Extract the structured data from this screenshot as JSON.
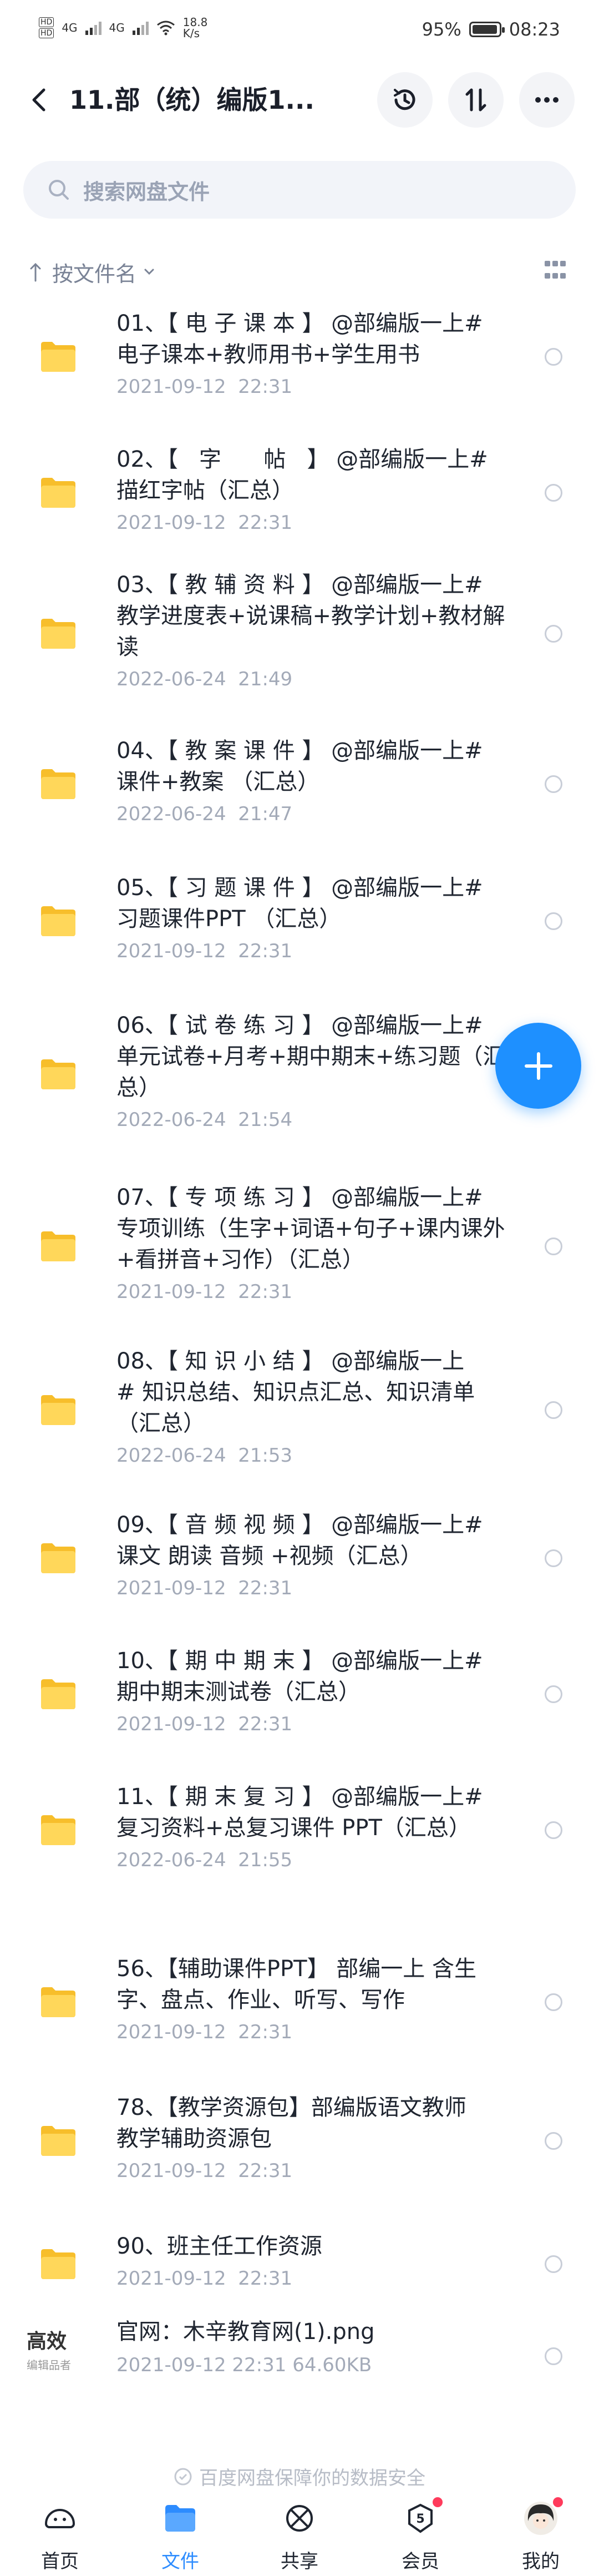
{
  "status": {
    "hd1": "HD",
    "hd2": "HD",
    "net1": "4G",
    "net2": "4G",
    "speed_value": "18.8",
    "speed_unit": "K/s",
    "battery_pct": "95%",
    "battery_level": 0.95,
    "time": "08:23"
  },
  "header": {
    "title": "11.部（统）编版1...",
    "back_icon": "chevron-left-icon",
    "history_icon": "history-icon",
    "transfer_icon": "transfer-icon",
    "more_icon": "more-icon"
  },
  "search": {
    "placeholder": "搜索网盘文件"
  },
  "sort": {
    "label": "按文件名"
  },
  "files": [
    {
      "lines": [
        "01、【 电 子 课 本 】 @部编版一上#",
        "电子课本+教师用书+学生用书"
      ],
      "date": "2021-09-12  22:31"
    },
    {
      "lines": [
        "02、【   字      帖   】 @部编版一上#",
        "描红字帖（汇总）"
      ],
      "date": "2021-09-12  22:31"
    },
    {
      "lines": [
        "03、【 教 辅 资 料 】 @部编版一上#",
        "教学进度表+说课稿+教学计划+教材解",
        "读"
      ],
      "date": "2022-06-24  21:49"
    },
    {
      "lines": [
        "04、【 教 案 课 件 】 @部编版一上#",
        "课件+教案 （汇总）"
      ],
      "date": "2022-06-24  21:47"
    },
    {
      "lines": [
        "05、【 习 题 课 件 】 @部编版一上#",
        "习题课件PPT （汇总）"
      ],
      "date": "2021-09-12  22:31"
    },
    {
      "lines": [
        "06、【 试 卷 练 习 】 @部编版一上#",
        "单元试卷+月考+期中期末+练习题（汇",
        "总）"
      ],
      "date": "2022-06-24  21:54"
    },
    {
      "lines": [
        "07、【 专 项 练 习 】 @部编版一上#",
        "专项训练（生字+词语+句子+课内课外",
        "+看拼音+习作）（汇总）"
      ],
      "date": "2021-09-12  22:31"
    },
    {
      "lines": [
        "08、【 知 识 小 结 】 @部编版一上",
        "# 知识总结、知识点汇总、知识清单",
        "（汇总）"
      ],
      "date": "2022-06-24  21:53"
    },
    {
      "lines": [
        "09、【 音 频 视 频 】 @部编版一上#",
        "课文 朗读 音频 +视频（汇总）"
      ],
      "date": "2021-09-12  22:31"
    },
    {
      "lines": [
        "10、【 期 中 期 末 】 @部编版一上#",
        "期中期末测试卷（汇总）"
      ],
      "date": "2021-09-12  22:31"
    },
    {
      "lines": [
        "11、【 期 末 复 习 】 @部编版一上#",
        "复习资料+总复习课件 PPT（汇总）"
      ],
      "date": "2022-06-24  21:55"
    },
    {
      "lines": [
        "56、【辅助课件PPT】 部编一上 含生",
        "字、盘点、作业、听写、写作"
      ],
      "date": "2021-09-12  22:31"
    },
    {
      "lines": [
        "78、【教学资源包】部编版语文教师",
        "教学辅助资源包"
      ],
      "date": "2021-09-12  22:31"
    },
    {
      "lines": [
        "90、班主任工作资源"
      ],
      "date": "2021-09-12  22:31"
    }
  ],
  "image_file": {
    "name": "官网：木辛教育网(1).png",
    "meta": "2021-09-12  22:31   64.60KB",
    "thumb_text": "高效",
    "thumb_sub": "编辑品者"
  },
  "footer_note": "百度网盘保障你的数据安全",
  "nav": [
    {
      "label": "首页",
      "icon": "home-icon"
    },
    {
      "label": "文件",
      "icon": "file-icon"
    },
    {
      "label": "共享",
      "icon": "share-icon"
    },
    {
      "label": "会员",
      "icon": "vip-icon"
    },
    {
      "label": "我的",
      "icon": "avatar-icon"
    }
  ],
  "colors": {
    "accent": "#2d8cff",
    "folder": "#ffd24a",
    "fab": "#1e90ff"
  }
}
